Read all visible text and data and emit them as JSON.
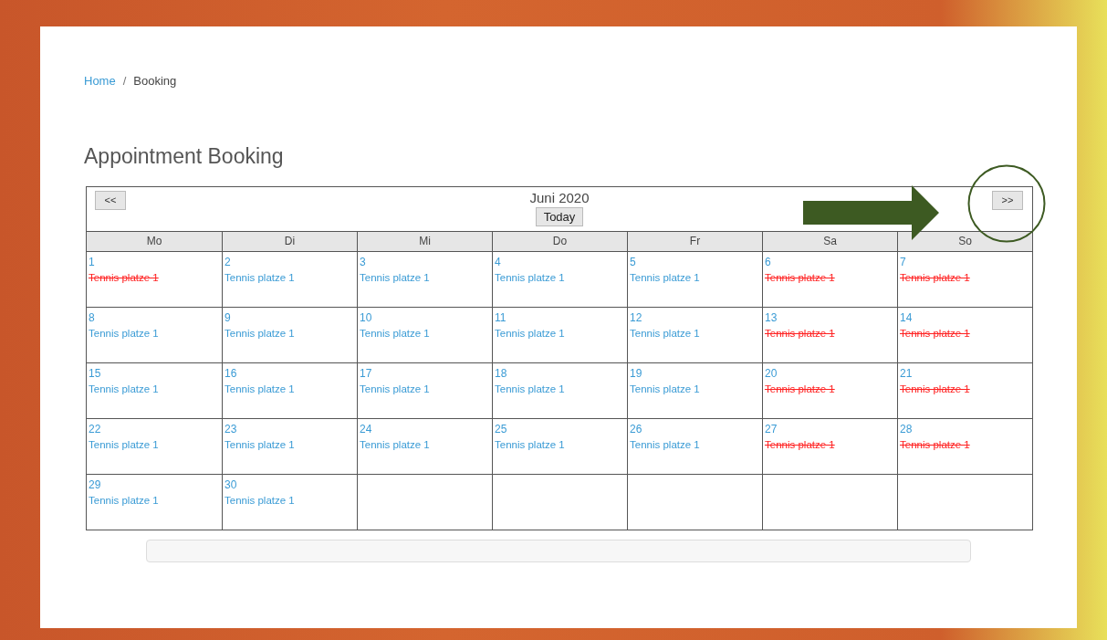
{
  "breadcrumb": [
    {
      "label": "Home",
      "kind": "link"
    },
    {
      "label": "Booking",
      "kind": "current"
    }
  ],
  "breadcrumb_separator": "/",
  "title": "Appointment Booking",
  "calendar": {
    "prev_button": "<<",
    "next_button": ">>",
    "month": "Juni 2020",
    "today_button": "Today",
    "weekdays": [
      "Mo",
      "Di",
      "Mi",
      "Do",
      "Fr",
      "Sa",
      "So"
    ],
    "weeks": [
      [
        {
          "day": "1",
          "slot": "Tennis platze 1",
          "booked": true
        },
        {
          "day": "2",
          "slot": "Tennis platze 1",
          "booked": false
        },
        {
          "day": "3",
          "slot": "Tennis platze 1",
          "booked": false
        },
        {
          "day": "4",
          "slot": "Tennis platze 1",
          "booked": false
        },
        {
          "day": "5",
          "slot": "Tennis platze 1",
          "booked": false
        },
        {
          "day": "6",
          "slot": "Tennis platze 1",
          "booked": true
        },
        {
          "day": "7",
          "slot": "Tennis platze 1",
          "booked": true
        }
      ],
      [
        {
          "day": "8",
          "slot": "Tennis platze 1",
          "booked": false
        },
        {
          "day": "9",
          "slot": "Tennis platze 1",
          "booked": false
        },
        {
          "day": "10",
          "slot": "Tennis platze 1",
          "booked": false
        },
        {
          "day": "11",
          "slot": "Tennis platze 1",
          "booked": false
        },
        {
          "day": "12",
          "slot": "Tennis platze 1",
          "booked": false
        },
        {
          "day": "13",
          "slot": "Tennis platze 1",
          "booked": true
        },
        {
          "day": "14",
          "slot": "Tennis platze 1",
          "booked": true
        }
      ],
      [
        {
          "day": "15",
          "slot": "Tennis platze 1",
          "booked": false
        },
        {
          "day": "16",
          "slot": "Tennis platze 1",
          "booked": false
        },
        {
          "day": "17",
          "slot": "Tennis platze 1",
          "booked": false
        },
        {
          "day": "18",
          "slot": "Tennis platze 1",
          "booked": false
        },
        {
          "day": "19",
          "slot": "Tennis platze 1",
          "booked": false
        },
        {
          "day": "20",
          "slot": "Tennis platze 1",
          "booked": true
        },
        {
          "day": "21",
          "slot": "Tennis platze 1",
          "booked": true
        }
      ],
      [
        {
          "day": "22",
          "slot": "Tennis platze 1",
          "booked": false
        },
        {
          "day": "23",
          "slot": "Tennis platze 1",
          "booked": false
        },
        {
          "day": "24",
          "slot": "Tennis platze 1",
          "booked": false
        },
        {
          "day": "25",
          "slot": "Tennis platze 1",
          "booked": false
        },
        {
          "day": "26",
          "slot": "Tennis platze 1",
          "booked": false
        },
        {
          "day": "27",
          "slot": "Tennis platze 1",
          "booked": true
        },
        {
          "day": "28",
          "slot": "Tennis platze 1",
          "booked": true
        }
      ],
      [
        {
          "day": "29",
          "slot": "Tennis platze 1",
          "booked": false
        },
        {
          "day": "30",
          "slot": "Tennis platze 1",
          "booked": false
        }
      ]
    ]
  }
}
